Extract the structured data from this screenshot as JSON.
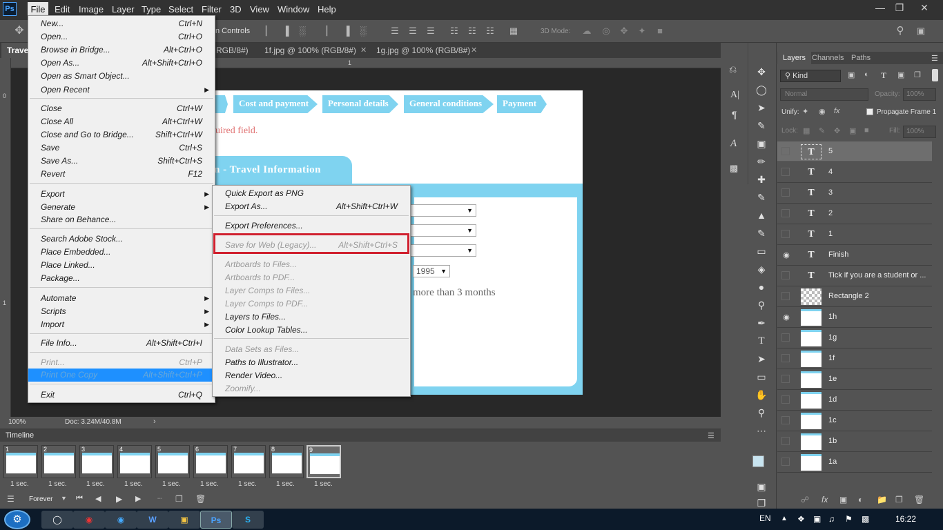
{
  "menubar": {
    "logo": "Ps",
    "items": [
      "File",
      "Edit",
      "Image",
      "Layer",
      "Type",
      "Select",
      "Filter",
      "3D",
      "View",
      "Window",
      "Help"
    ]
  },
  "optionsbar": {
    "controls_label": "n Controls",
    "mode_label": "3D Mode:"
  },
  "tabs": [
    "Travel",
    "RGB/8#)",
    "1f.jpg @ 100% (RGB/8#)",
    "1g.jpg @ 100% (RGB/8#)"
  ],
  "ruler": {
    "h0": "0",
    "h1": "1",
    "v0": "0",
    "v1": "1"
  },
  "document": {
    "steps": [
      "Cost and payment",
      "Personal details",
      "General conditions",
      "Payment"
    ],
    "required_text": "uired field.",
    "section_title": "n - Travel Information",
    "year": "1995",
    "months_text": "more than 3 months"
  },
  "status": {
    "zoom": "100%",
    "doc": "Doc: 3.24M/40.8M"
  },
  "file_menu": {
    "items": [
      {
        "label": "New...",
        "shortcut": "Ctrl+N"
      },
      {
        "label": "Open...",
        "shortcut": "Ctrl+O"
      },
      {
        "label": "Browse in Bridge...",
        "shortcut": "Alt+Ctrl+O"
      },
      {
        "label": "Open As...",
        "shortcut": "Alt+Shift+Ctrl+O"
      },
      {
        "label": "Open as Smart Object...",
        "shortcut": ""
      },
      {
        "label": "Open Recent",
        "shortcut": ""
      },
      {
        "label": "Close",
        "shortcut": "Ctrl+W"
      },
      {
        "label": "Close All",
        "shortcut": "Alt+Ctrl+W"
      },
      {
        "label": "Close and Go to Bridge...",
        "shortcut": "Shift+Ctrl+W"
      },
      {
        "label": "Save",
        "shortcut": "Ctrl+S"
      },
      {
        "label": "Save As...",
        "shortcut": "Shift+Ctrl+S"
      },
      {
        "label": "Revert",
        "shortcut": "F12"
      },
      {
        "label": "Export",
        "shortcut": ""
      },
      {
        "label": "Generate",
        "shortcut": ""
      },
      {
        "label": "Share on Behance...",
        "shortcut": ""
      },
      {
        "label": "Search Adobe Stock...",
        "shortcut": ""
      },
      {
        "label": "Place Embedded...",
        "shortcut": ""
      },
      {
        "label": "Place Linked...",
        "shortcut": ""
      },
      {
        "label": "Package...",
        "shortcut": ""
      },
      {
        "label": "Automate",
        "shortcut": ""
      },
      {
        "label": "Scripts",
        "shortcut": ""
      },
      {
        "label": "Import",
        "shortcut": ""
      },
      {
        "label": "File Info...",
        "shortcut": "Alt+Shift+Ctrl+I"
      },
      {
        "label": "Print...",
        "shortcut": "Ctrl+P"
      },
      {
        "label": "Print One Copy",
        "shortcut": "Alt+Shift+Ctrl+P"
      },
      {
        "label": "Exit",
        "shortcut": "Ctrl+Q"
      }
    ]
  },
  "export_submenu": {
    "items": [
      {
        "label": "Quick Export as PNG",
        "shortcut": ""
      },
      {
        "label": "Export As...",
        "shortcut": "Alt+Shift+Ctrl+W"
      },
      {
        "label": "Export Preferences...",
        "shortcut": ""
      },
      {
        "label": "Save for Web (Legacy)...",
        "shortcut": "Alt+Shift+Ctrl+S"
      },
      {
        "label": "Artboards to Files...",
        "shortcut": ""
      },
      {
        "label": "Artboards to PDF...",
        "shortcut": ""
      },
      {
        "label": "Layer Comps to Files...",
        "shortcut": ""
      },
      {
        "label": "Layer Comps to PDF...",
        "shortcut": ""
      },
      {
        "label": "Layers to Files...",
        "shortcut": ""
      },
      {
        "label": "Color Lookup Tables...",
        "shortcut": ""
      },
      {
        "label": "Data Sets as Files...",
        "shortcut": ""
      },
      {
        "label": "Paths to Illustrator...",
        "shortcut": ""
      },
      {
        "label": "Render Video...",
        "shortcut": ""
      },
      {
        "label": "Zoomify...",
        "shortcut": ""
      }
    ]
  },
  "timeline": {
    "title": "Timeline",
    "frames": [
      "1",
      "2",
      "3",
      "4",
      "5",
      "6",
      "7",
      "8",
      "9"
    ],
    "delay": "1 sec.",
    "loop": "Forever"
  },
  "layers_panel": {
    "tabs": [
      "Layers",
      "Channels",
      "Paths"
    ],
    "kind": "Kind",
    "blend": "Normal",
    "opacity_label": "Opacity:",
    "opacity": "100%",
    "unify": "Unify:",
    "propagate": "Propagate Frame 1",
    "lock": "Lock:",
    "fill_label": "Fill:",
    "fill": "100%",
    "layers": [
      {
        "name": "5",
        "type": "text"
      },
      {
        "name": "4",
        "type": "text"
      },
      {
        "name": "3",
        "type": "text"
      },
      {
        "name": "2",
        "type": "text"
      },
      {
        "name": "1",
        "type": "text"
      },
      {
        "name": "Finish",
        "type": "text"
      },
      {
        "name": "Tick if you are a student or ...",
        "type": "text"
      },
      {
        "name": "Rectangle 2",
        "type": "shape"
      },
      {
        "name": "1h",
        "type": "image"
      },
      {
        "name": "1g",
        "type": "image"
      },
      {
        "name": "1f",
        "type": "image"
      },
      {
        "name": "1e",
        "type": "image"
      },
      {
        "name": "1d",
        "type": "image"
      },
      {
        "name": "1c",
        "type": "image"
      },
      {
        "name": "1b",
        "type": "image"
      },
      {
        "name": "1a",
        "type": "image"
      }
    ]
  },
  "taskbar": {
    "lang": "EN",
    "time": "16:22"
  },
  "colors": {
    "accent": "#7fd3f0",
    "highlight_box": "#d0202e",
    "menu_highlight": "#1e90ff"
  }
}
